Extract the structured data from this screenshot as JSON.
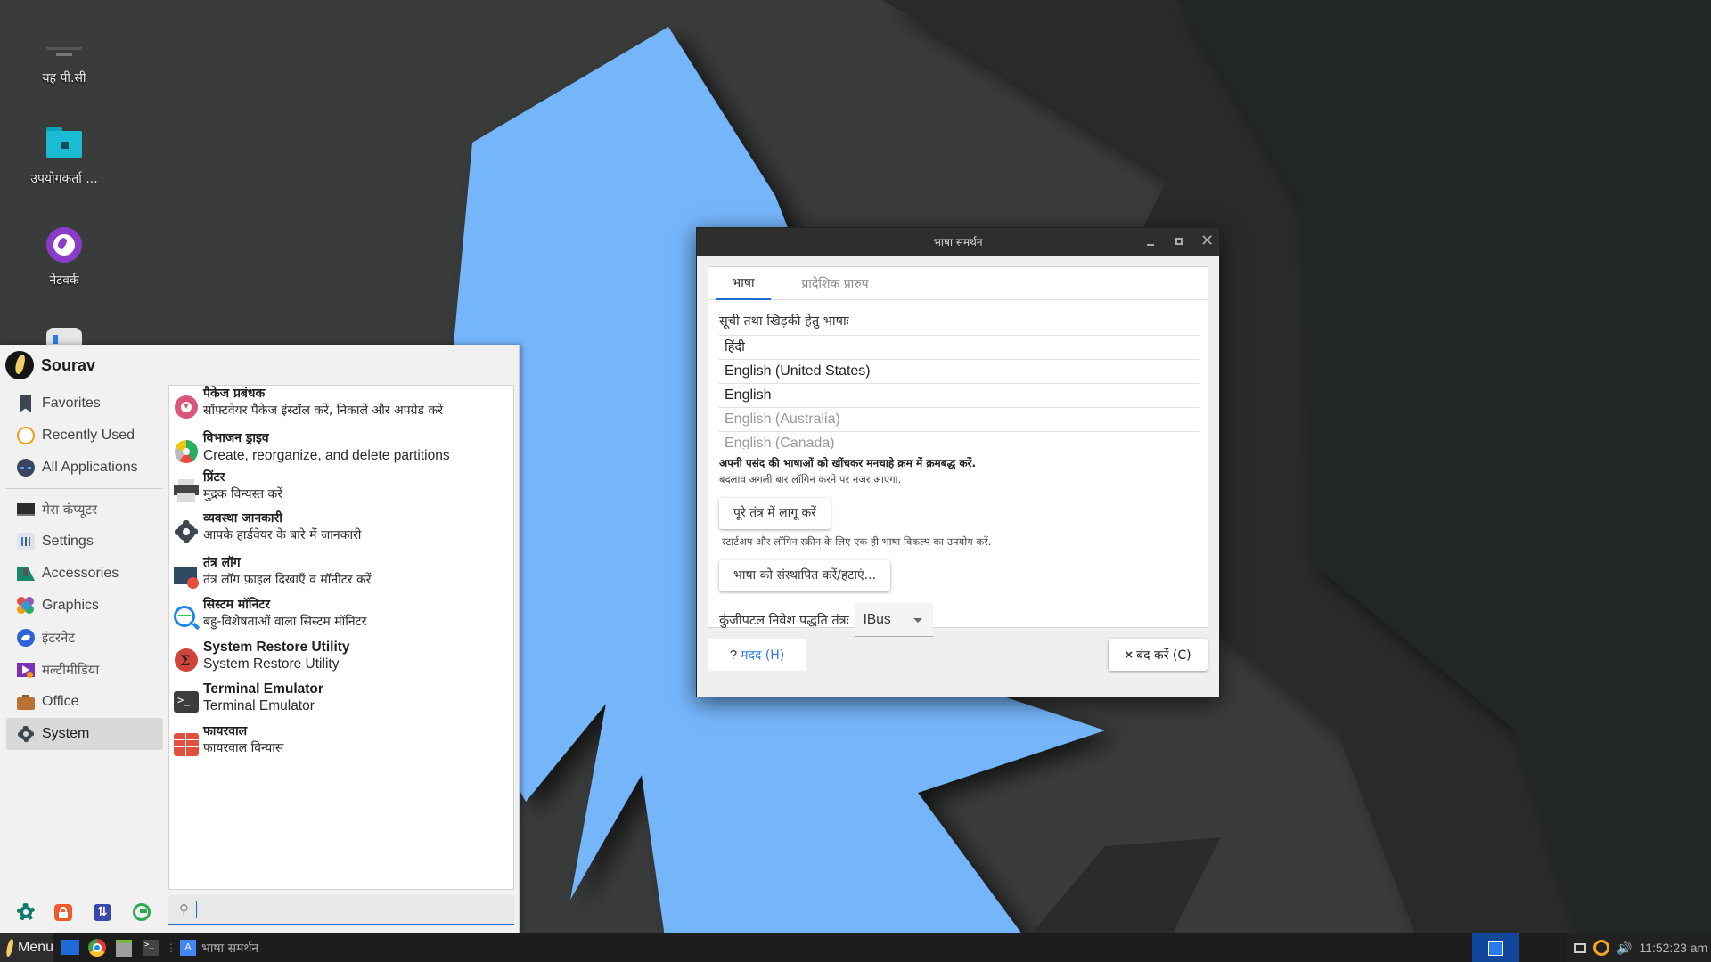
{
  "desktop": {
    "icons": [
      {
        "label": "यह पी.सी",
        "icon": "computer-icon"
      },
      {
        "label": "उपयोगकर्ता ...",
        "icon": "home-folder-icon"
      },
      {
        "label": "नेटवर्क",
        "icon": "network-icon"
      }
    ]
  },
  "menu": {
    "user": "Sourav",
    "categories": [
      {
        "label": "Favorites",
        "icon": "bookmark-icon"
      },
      {
        "label": "Recently Used",
        "icon": "clock-icon"
      },
      {
        "label": "All Applications",
        "icon": "all-apps-icon"
      },
      {
        "label": "मेरा कंप्यूटर",
        "icon": "computer-icon"
      },
      {
        "label": "Settings",
        "icon": "settings-icon"
      },
      {
        "label": "Accessories",
        "icon": "accessories-icon"
      },
      {
        "label": "Graphics",
        "icon": "graphics-icon"
      },
      {
        "label": "इंटरनेट",
        "icon": "internet-icon"
      },
      {
        "label": "मल्टीमीडिया",
        "icon": "multimedia-icon"
      },
      {
        "label": "Office",
        "icon": "briefcase-icon"
      },
      {
        "label": "System",
        "icon": "gear-icon",
        "active": true
      }
    ],
    "apps": [
      {
        "name": "पैकेज प्रबंधक",
        "desc": "सॉफ़्टवेयर पैकेज इंस्टॉल करें, निकालें और अपग्रेड करें",
        "icon": "package-manager-icon"
      },
      {
        "name": "विभाजन ड्राइव",
        "desc": "Create, reorganize, and delete partitions",
        "icon": "partition-icon"
      },
      {
        "name": "प्रिंटर",
        "desc": "मुद्रक विन्यस्त करें",
        "icon": "printer-icon"
      },
      {
        "name": "व्यवस्था जानकारी",
        "desc": "आपके हार्डवेयर के बारे में जानकारी",
        "icon": "gear-icon"
      },
      {
        "name": "तंत्र लॉग",
        "desc": "तंत्र लॉग फ़ाइल दिखाएँ व मॉनीटर करें",
        "icon": "system-log-icon"
      },
      {
        "name": "सिस्टम मॉनिटर",
        "desc": "बहु-विशेषताओं वाला सिस्टम मॉनिटर",
        "icon": "system-monitor-icon"
      },
      {
        "name": "System Restore Utility",
        "desc": "System Restore Utility",
        "icon": "restore-icon"
      },
      {
        "name": "Terminal Emulator",
        "desc": "Terminal Emulator",
        "icon": "terminal-icon"
      },
      {
        "name": "फायरवाल",
        "desc": "फायरवाल विन्यास",
        "icon": "firewall-icon"
      }
    ],
    "quick_buttons": [
      "software-manager-icon",
      "lock-icon",
      "switch-user-icon",
      "logout-icon"
    ],
    "search": {
      "value": "",
      "placeholder": ""
    }
  },
  "taskbar": {
    "menu_label": "Menu",
    "launchers": [
      "show-desktop-icon",
      "chrome-icon",
      "files-icon",
      "terminal-icon"
    ],
    "task": {
      "label": "भाषा समर्थन",
      "icon": "language-icon"
    },
    "clock": "11:52:23 am",
    "tray": [
      "display-icon",
      "update-icon",
      "volume-icon"
    ]
  },
  "dialog": {
    "title": "भाषा समर्थन",
    "tabs": [
      {
        "label": "भाषा",
        "active": true
      },
      {
        "label": "प्रादेशिक प्रारुप",
        "active": false
      }
    ],
    "list_label": "सूची तथा खिड़की हेतु भाषाः",
    "languages": [
      {
        "label": "हिंदी",
        "dim": false
      },
      {
        "label": "English (United States)",
        "dim": false
      },
      {
        "label": "English",
        "dim": false
      },
      {
        "label": "English (Australia)",
        "dim": true
      },
      {
        "label": "English (Canada)",
        "dim": true
      }
    ],
    "drag_note": "अपनी पसंद की भाषाओं को खींचकर मनचाहे क्रम में क्रमबद्ध करें.",
    "change_note": "बदलाव अगली बार लॉगिन करने पर नजर आएगा.",
    "apply_button": "पूरे तंत्र में लागू करें",
    "apply_note": "स्टार्टअप और लॉगिन स्क्रीन के लिए एक ही भाषा विकल्प का उपयोग करें.",
    "install_button": "भाषा को संस्थापित करें/हटाएं...",
    "ime_label": "कुंजीपटल निवेश पद्धति तंत्रः",
    "ime_value": "IBus",
    "help_button": {
      "mark": "?",
      "label": "मदद (H)"
    },
    "close_button": {
      "mark": "×",
      "label": "बंद करें (C)"
    },
    "colors": {
      "accent": "#1e6ad6",
      "link": "#2f7ae5"
    }
  }
}
